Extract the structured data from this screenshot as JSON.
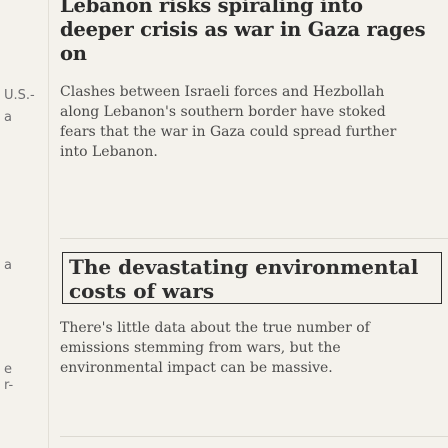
{
  "left_fragments": [
    {
      "text": "U.S.-"
    },
    {
      "text": "a"
    },
    {
      "text": "a"
    },
    {
      "text": "e"
    },
    {
      "text": "r-"
    }
  ],
  "story1": {
    "title": "Lebanon risks spiraling into deeper crisis as war in Gaza rages on",
    "title_lines": [
      "Lebanon risks spiraling into",
      "deeper crisis as war in Gaza rages",
      "on"
    ],
    "summary_lines": [
      "Clashes between Israeli forces and Hezbollah",
      "along Lebanon's southern border have stoked",
      "fears that the war in Gaza could spread further",
      "into Lebanon."
    ]
  },
  "story2": {
    "title_lines": [
      "The devastating environmental",
      "costs of wars"
    ],
    "summary_lines": [
      "There's little data about the true number of",
      "emissions stemming from wars, but the",
      "environmental impact can be massive."
    ]
  }
}
